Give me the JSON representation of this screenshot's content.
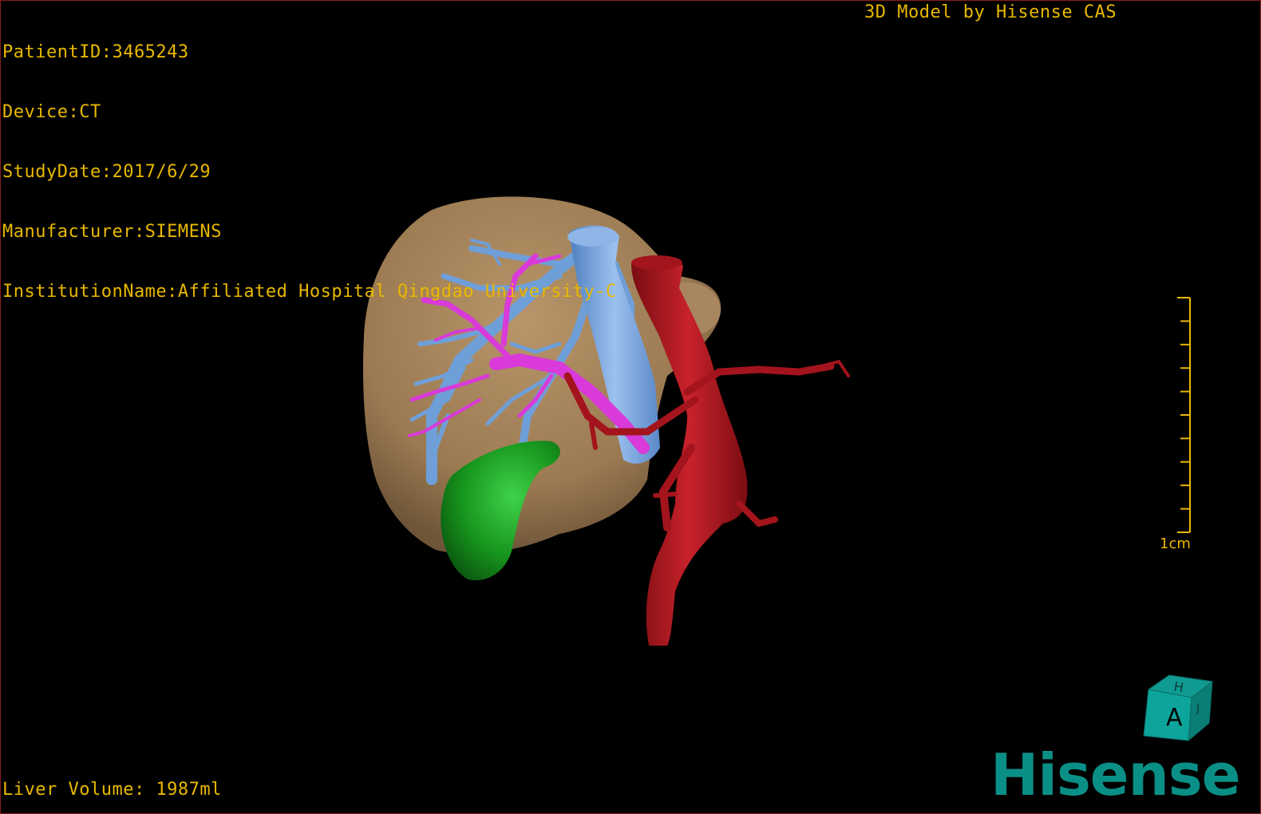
{
  "patient_info": {
    "patient_id": "PatientID:3465243",
    "device": "Device:CT",
    "study_date": "StudyDate:2017/6/29",
    "manufacturer": "Manufacturer:SIEMENS",
    "institution": "InstitutionName:Affiliated Hospital Qingdao University-C"
  },
  "brand_credit": "3D Model by Hisense CAS",
  "volume_readout": "Liver Volume: 1987ml",
  "scale_bar": {
    "label": "1cm",
    "tick_count": 10
  },
  "orientation_cube": {
    "front_face": "A",
    "top_face": "H",
    "side_face": "J"
  },
  "logo": "Hisense",
  "colors": {
    "overlay_text": "#e8b800",
    "liver": "#a5825a",
    "hepatic_veins": "#6f9fd8",
    "portal_vein": "#d93ad9",
    "arteries": "#a3141c",
    "gallbladder": "#1a9a1a",
    "logo": "#0a8f86",
    "cube": "#0a8f86"
  },
  "structures": [
    "liver",
    "hepatic-vein-tree",
    "portal-vein-tree",
    "artery-tree",
    "gallbladder"
  ]
}
